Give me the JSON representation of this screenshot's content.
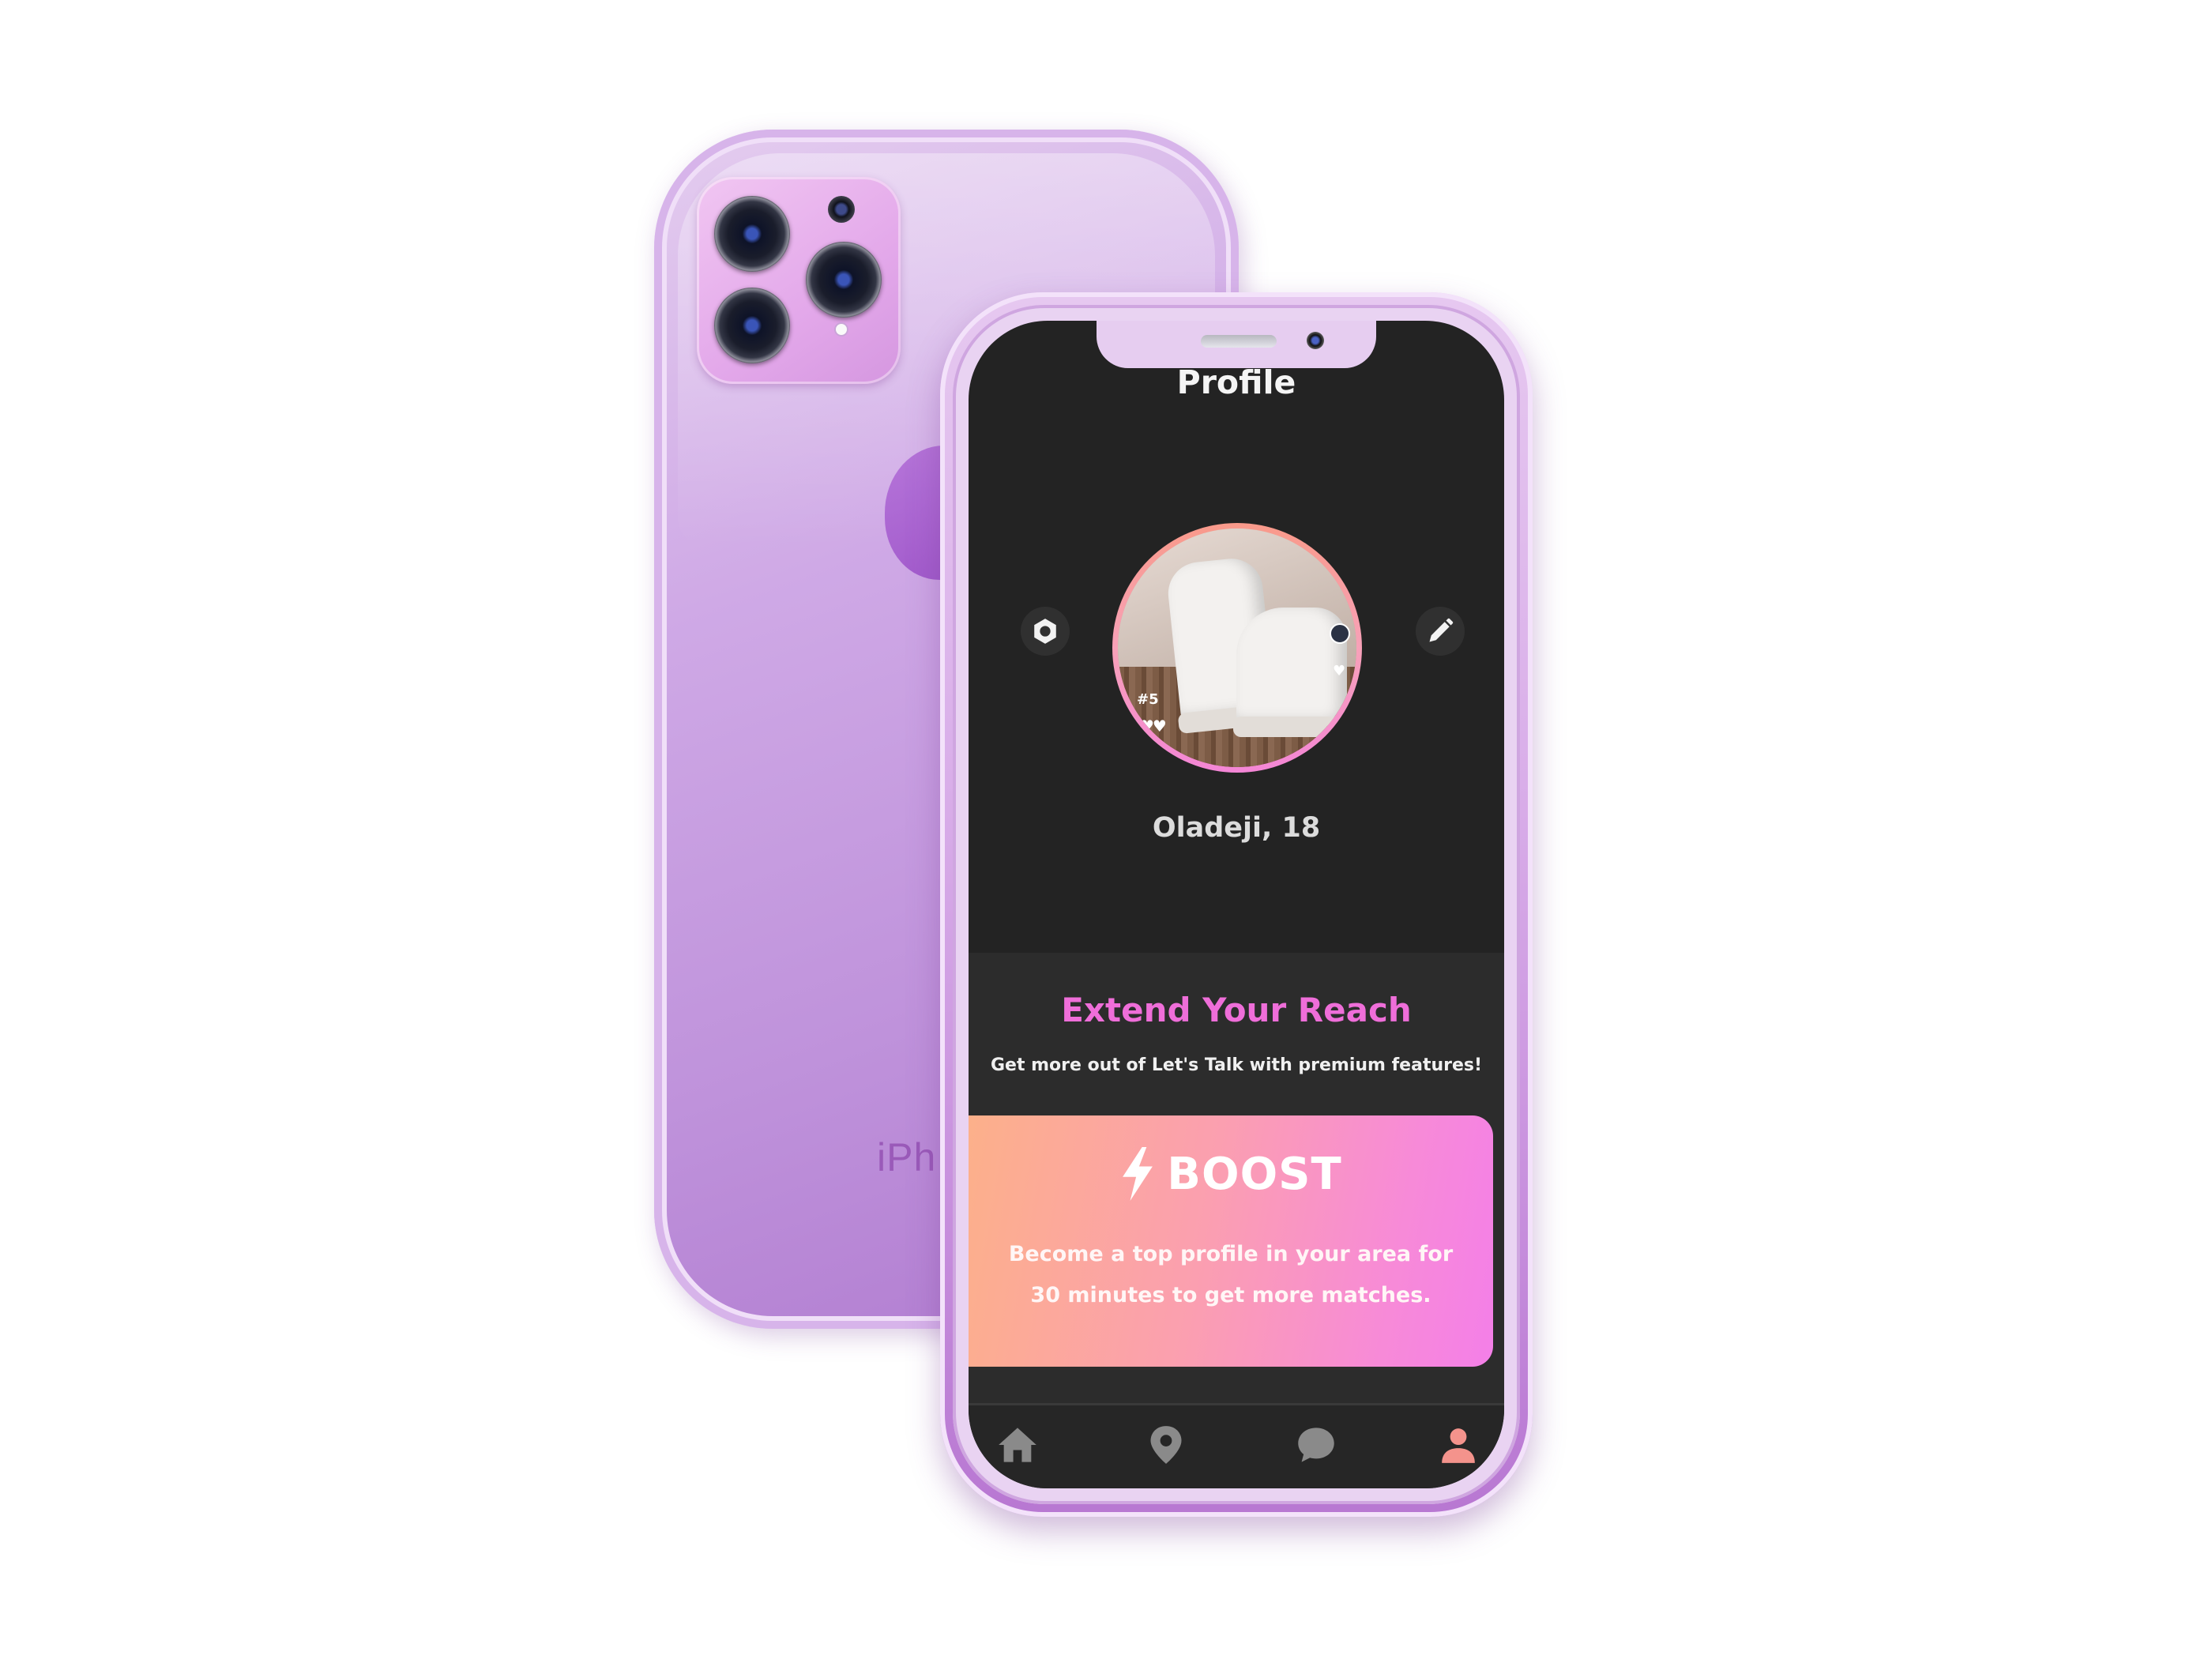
{
  "back_phone": {
    "brand_text": "iPh"
  },
  "screen": {
    "title": "Profile",
    "user": {
      "name_age": "Oladeji, 18",
      "avatar_badge": "#5"
    },
    "promo": {
      "title": "Extend Your Reach",
      "subtitle": "Get more out of Let's Talk with premium features!",
      "boost": {
        "label": "BOOST",
        "description": "Become a top profile in your area for 30 minutes to get more matches."
      }
    },
    "tabs": [
      {
        "name": "home",
        "icon": "home-icon",
        "active": false
      },
      {
        "name": "map",
        "icon": "location-pin-icon",
        "active": false
      },
      {
        "name": "chat",
        "icon": "chat-bubble-icon",
        "active": false
      },
      {
        "name": "profile",
        "icon": "person-icon",
        "active": true
      }
    ]
  },
  "colors": {
    "accent_pink": "#ef6ed9",
    "active_tab": "#f4938c",
    "inactive_tab": "#8a8a8a",
    "screen_bg": "#232323"
  }
}
